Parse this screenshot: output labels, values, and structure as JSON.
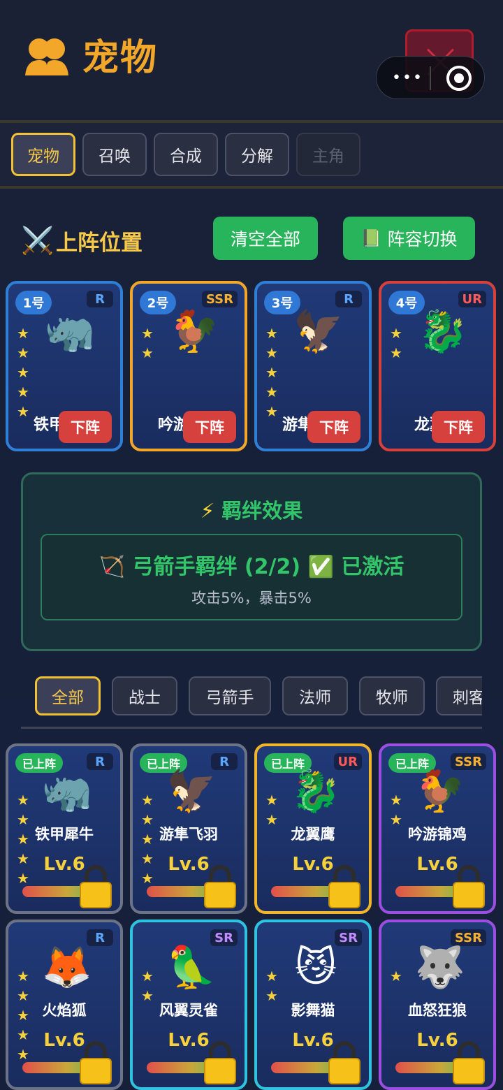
{
  "header": {
    "title": "宠物"
  },
  "tabs": [
    {
      "label": "宠物",
      "state": "active"
    },
    {
      "label": "召唤",
      "state": "normal"
    },
    {
      "label": "合成",
      "state": "normal"
    },
    {
      "label": "分解",
      "state": "normal"
    },
    {
      "label": "主角",
      "state": "disabled"
    }
  ],
  "lineup": {
    "title": "上阵位置",
    "clear_label": "清空全部",
    "switch_label": "阵容切换",
    "slots": [
      {
        "num": "1号",
        "rarity": "R",
        "name": "铁甲犀牛",
        "emoji": "🦏",
        "stars": 5,
        "remove_label": "下阵"
      },
      {
        "num": "2号",
        "rarity": "SSR",
        "name": "吟游锦鸡",
        "emoji": "🐓",
        "stars": 2,
        "remove_label": "下阵"
      },
      {
        "num": "3号",
        "rarity": "R",
        "name": "游隼飞羽",
        "emoji": "🦅",
        "stars": 5,
        "remove_label": "下阵"
      },
      {
        "num": "4号",
        "rarity": "UR",
        "name": "龙翼鹰",
        "emoji": "🐉",
        "stars": 2,
        "remove_label": "下阵"
      }
    ]
  },
  "bond": {
    "title": "羁绊效果",
    "name": "弓箭手羁绊 (2/2)",
    "status": "已激活",
    "desc": "攻击5%，暴击5%"
  },
  "filters": [
    "全部",
    "战士",
    "弓箭手",
    "法师",
    "牧师",
    "刺客"
  ],
  "pets": [
    {
      "name": "铁甲犀牛",
      "rarity": "R",
      "emoji": "🦏",
      "stars": 5,
      "level": "Lv.6",
      "deployed": true,
      "badge": "已上阵",
      "border": "#6d7387"
    },
    {
      "name": "游隼飞羽",
      "rarity": "R",
      "emoji": "🦅",
      "stars": 5,
      "level": "Lv.6",
      "deployed": true,
      "badge": "已上阵",
      "border": "#6d7387"
    },
    {
      "name": "龙翼鹰",
      "rarity": "UR",
      "emoji": "🐉",
      "stars": 2,
      "level": "Lv.6",
      "deployed": true,
      "badge": "已上阵",
      "border": "#f2b52a"
    },
    {
      "name": "吟游锦鸡",
      "rarity": "SSR",
      "emoji": "🐓",
      "stars": 2,
      "level": "Lv.6",
      "deployed": true,
      "badge": "已上阵",
      "border": "#9b4fe0"
    },
    {
      "name": "火焰狐",
      "rarity": "R",
      "emoji": "🦊",
      "stars": 5,
      "level": "Lv.6",
      "deployed": false,
      "badge": "",
      "border": "#6d7387"
    },
    {
      "name": "风翼灵雀",
      "rarity": "SR",
      "emoji": "🦜",
      "stars": 2,
      "level": "Lv.6",
      "deployed": false,
      "badge": "",
      "border": "#2fc3e0"
    },
    {
      "name": "影舞猫",
      "rarity": "SR",
      "emoji": "😼",
      "stars": 2,
      "level": "Lv.6",
      "deployed": false,
      "badge": "",
      "border": "#2fc3e0"
    },
    {
      "name": "血怒狂狼",
      "rarity": "SSR",
      "emoji": "🐺",
      "stars": 1,
      "level": "Lv.6",
      "deployed": false,
      "badge": "",
      "border": "#9b4fe0"
    }
  ]
}
